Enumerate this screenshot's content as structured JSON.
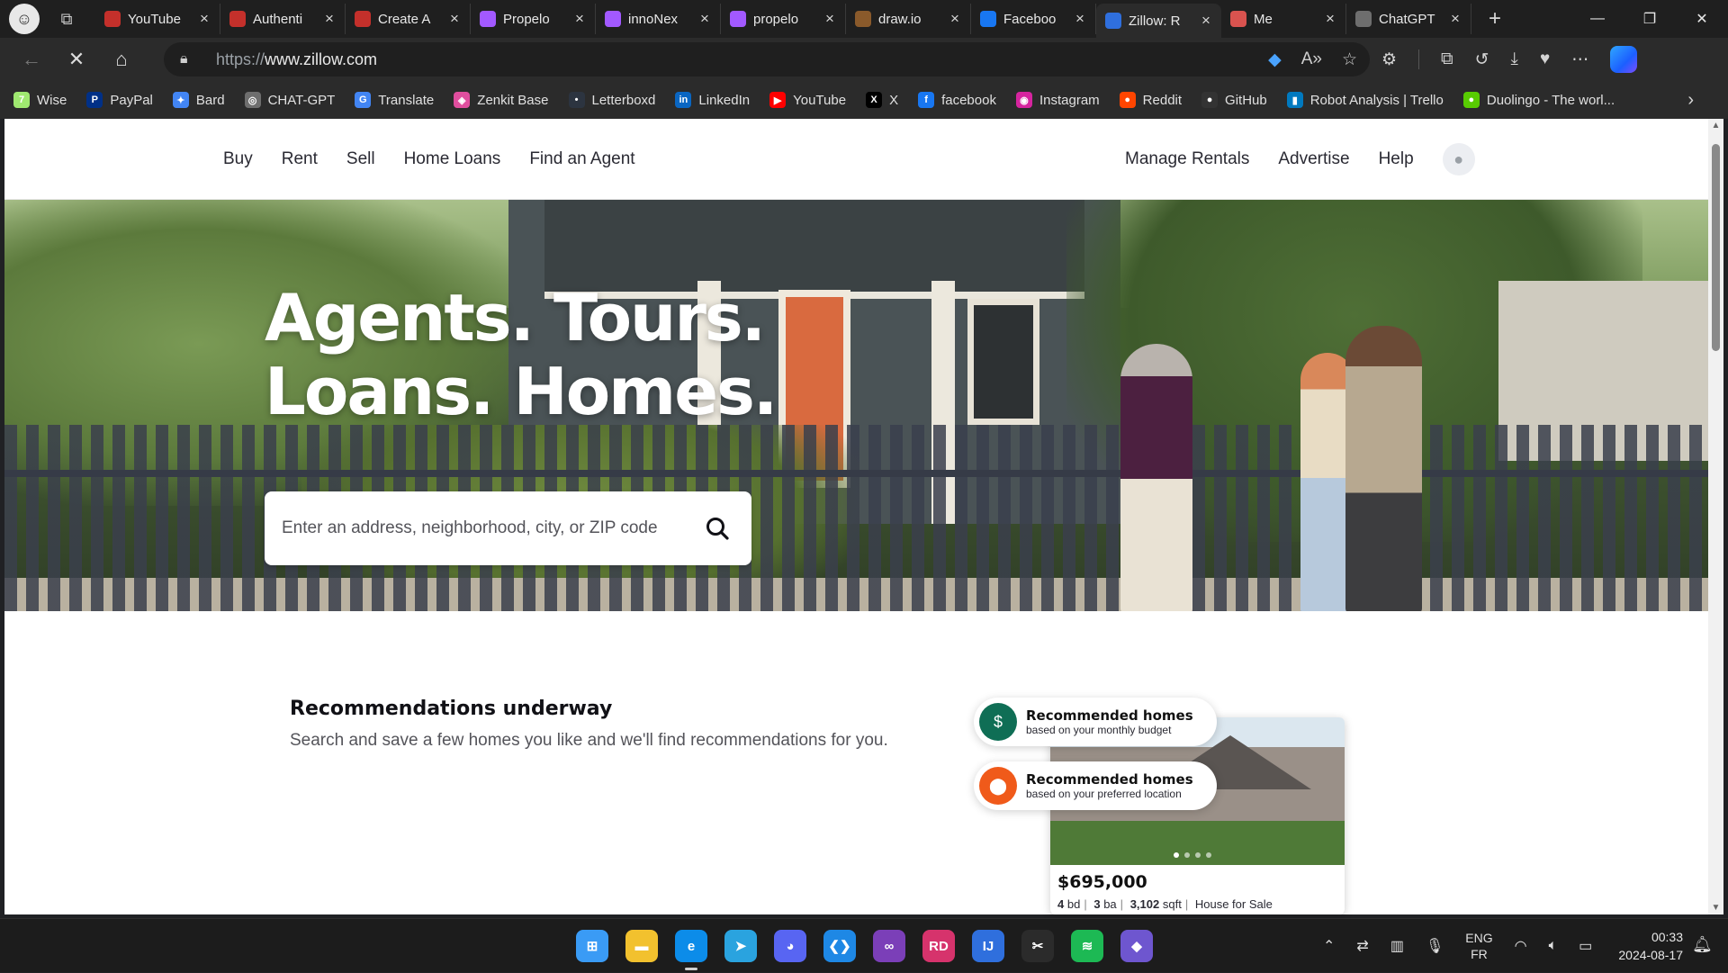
{
  "browser": {
    "tabs": [
      {
        "label": "YouTube",
        "color": "#c4302b"
      },
      {
        "label": "Authenti",
        "color": "#c4302b"
      },
      {
        "label": "Create A",
        "color": "#c4302b"
      },
      {
        "label": "Propelo",
        "color": "#a259ff"
      },
      {
        "label": "innoNex",
        "color": "#a259ff"
      },
      {
        "label": "propelo",
        "color": "#a259ff"
      },
      {
        "label": "draw.io",
        "color": "#8a5a2b"
      },
      {
        "label": "Faceboo",
        "color": "#1877f2"
      },
      {
        "label": "Zillow: R",
        "color": "#2f6fdd",
        "active": true
      },
      {
        "label": "Me",
        "color": "#d9534f"
      },
      {
        "label": "ChatGPT",
        "color": "#6e6e6e"
      }
    ],
    "new_tab": "+",
    "url_scheme": "https://",
    "url_host": "www.zillow.com",
    "bookmarks": [
      {
        "label": "Wise",
        "color": "#9fe870",
        "glyph": "7"
      },
      {
        "label": "PayPal",
        "color": "#003087",
        "glyph": "P"
      },
      {
        "label": "Bard",
        "color": "#4285f4",
        "glyph": "✦"
      },
      {
        "label": "CHAT-GPT",
        "color": "#6e6e6e",
        "glyph": "◎"
      },
      {
        "label": "Translate",
        "color": "#4285f4",
        "glyph": "G"
      },
      {
        "label": "Zenkit Base",
        "color": "#e04e9e",
        "glyph": "◈"
      },
      {
        "label": "Letterboxd",
        "color": "#2c3440",
        "glyph": "•"
      },
      {
        "label": "LinkedIn",
        "color": "#0a66c2",
        "glyph": "in"
      },
      {
        "label": "YouTube",
        "color": "#ff0000",
        "glyph": "▶"
      },
      {
        "label": "X",
        "color": "#000000",
        "glyph": "X"
      },
      {
        "label": "facebook",
        "color": "#1877f2",
        "glyph": "f"
      },
      {
        "label": "Instagram",
        "color": "#d6249f",
        "glyph": "◉"
      },
      {
        "label": "Reddit",
        "color": "#ff4500",
        "glyph": "●"
      },
      {
        "label": "GitHub",
        "color": "#333333",
        "glyph": "●"
      },
      {
        "label": "Robot Analysis | Trello",
        "color": "#0079bf",
        "glyph": "▮"
      },
      {
        "label": "Duolingo - The worl...",
        "color": "#58cc02",
        "glyph": "●"
      }
    ]
  },
  "zillow": {
    "nav_left": [
      "Buy",
      "Rent",
      "Sell",
      "Home Loans",
      "Find an Agent"
    ],
    "nav_right": [
      "Manage Rentals",
      "Advertise",
      "Help"
    ],
    "hero_line1": "Agents. Tours.",
    "hero_line2": "Loans. Homes.",
    "search_placeholder": "Enter an address, neighborhood, city, or ZIP code",
    "rec_title": "Recommendations underway",
    "rec_subtitle": "Search and save a few homes you like and we'll find recommendations for you.",
    "pill1_title": "Recommended homes",
    "pill1_sub": "based on your monthly budget",
    "pill1_color": "#0f6e55",
    "pill2_title": "Recommended homes",
    "pill2_sub": "based on your preferred location",
    "pill2_color": "#f05a1a",
    "card_price": "$695,000",
    "card_beds": "4",
    "card_beds_unit": "bd",
    "card_baths": "3",
    "card_baths_unit": "ba",
    "card_sqft": "3,102",
    "card_sqft_unit": "sqft",
    "card_type": "House for Sale"
  },
  "taskbar": {
    "apps": [
      {
        "name": "windows-start",
        "color": "#3a9bf5",
        "glyph": "⊞"
      },
      {
        "name": "file-explorer",
        "color": "#f2c12e",
        "glyph": "▬"
      },
      {
        "name": "edge",
        "color": "#0c8ce9",
        "glyph": "e",
        "active": true
      },
      {
        "name": "telegram",
        "color": "#2aa3df",
        "glyph": "➤"
      },
      {
        "name": "discord",
        "color": "#5865f2",
        "glyph": "◕"
      },
      {
        "name": "vscode",
        "color": "#1e88e5",
        "glyph": "❮❯"
      },
      {
        "name": "visual-studio",
        "color": "#7b3fb8",
        "glyph": "∞"
      },
      {
        "name": "rider",
        "color": "#d6336c",
        "glyph": "RD"
      },
      {
        "name": "intellij",
        "color": "#2f6fdd",
        "glyph": "IJ"
      },
      {
        "name": "capcut",
        "color": "#2b2b2b",
        "glyph": "✂"
      },
      {
        "name": "spotify",
        "color": "#1db954",
        "glyph": "≋"
      },
      {
        "name": "other-app",
        "color": "#6e56cf",
        "glyph": "◆"
      }
    ],
    "lang_top": "ENG",
    "lang_bottom": "FR",
    "time": "00:33",
    "date": "2024-08-17"
  }
}
